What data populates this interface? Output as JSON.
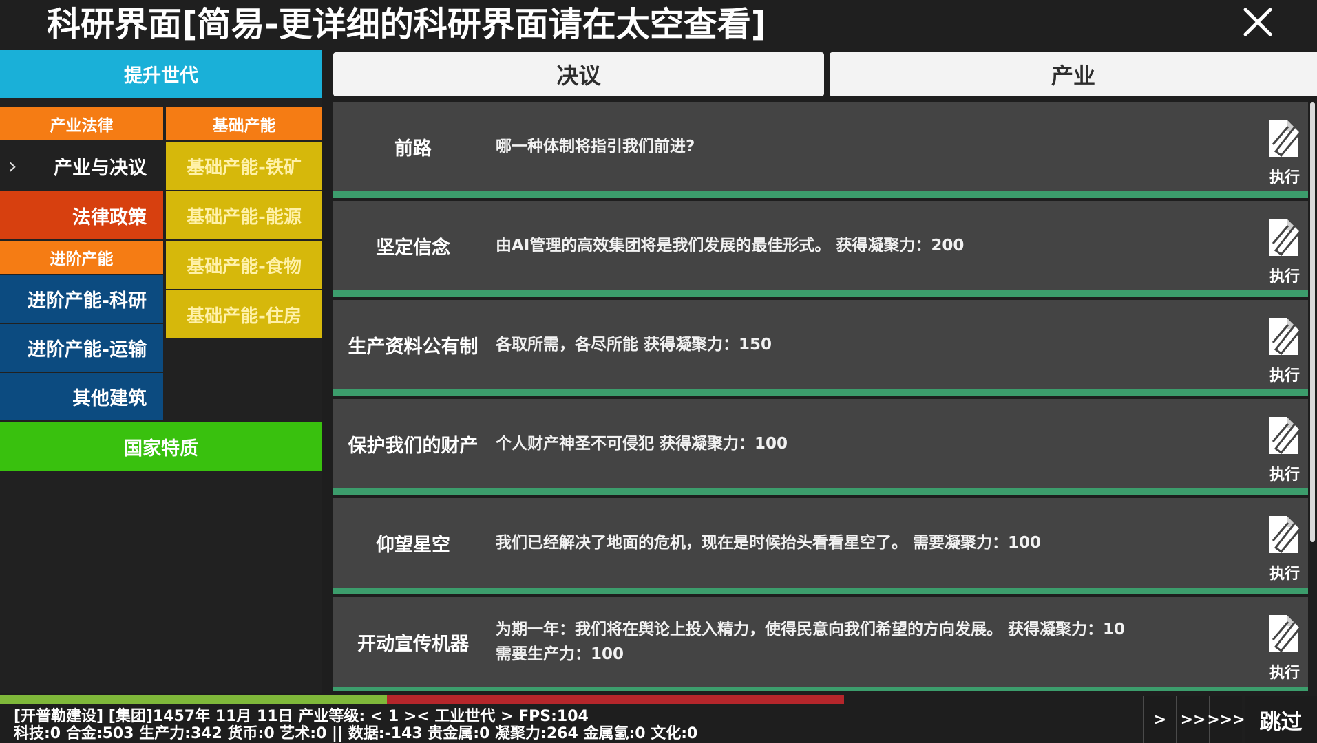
{
  "window": {
    "title": "科研界面[简易-更详细的科研界面请在太空查看]",
    "close_icon": "close-icon"
  },
  "sidebar": {
    "upgrade_label": "提升世代",
    "industry_law_header": "产业法律",
    "basic_capacity_header": "基础产能",
    "industry_decision_label": "产业与决议",
    "law_policy_label": "法律政策",
    "advanced_capacity_header": "进阶产能",
    "advanced_research_label": "进阶产能-科研",
    "advanced_transport_label": "进阶产能-运输",
    "other_buildings_label": "其他建筑",
    "basic_iron_label": "基础产能-铁矿",
    "basic_energy_label": "基础产能-能源",
    "basic_food_label": "基础产能-食物",
    "basic_housing_label": "基础产能-住房",
    "national_traits_label": "国家特质",
    "chevron_icon": "chevron-right-icon"
  },
  "tabs": {
    "resolution": "决议",
    "industry": "产业"
  },
  "decisions": [
    {
      "name": "前路",
      "desc": "哪一种体制将指引我们前进?",
      "desc2": "",
      "action": "执行"
    },
    {
      "name": "坚定信念",
      "desc": "由AI管理的高效集团将是我们发展的最佳形式。 获得凝聚力：200",
      "desc2": "",
      "action": "执行"
    },
    {
      "name": "生产资料公有制",
      "desc": "各取所需，各尽所能 获得凝聚力：150",
      "desc2": "",
      "action": "执行"
    },
    {
      "name": "保护我们的财产",
      "desc": "个人财产神圣不可侵犯 获得凝聚力：100",
      "desc2": "",
      "action": "执行"
    },
    {
      "name": "仰望星空",
      "desc": "我们已经解决了地面的危机，现在是时候抬头看看星空了。 需要凝聚力：100",
      "desc2": "",
      "action": "执行"
    },
    {
      "name": "开动宣传机器",
      "desc": "为期一年：我们将在舆论上投入精力，使得民意向我们希望的方向发展。 获得凝聚力：10",
      "desc2": "需要生产力：100",
      "action": "执行"
    }
  ],
  "status": {
    "line1": "[开普勒建设] [集团]1457年 11月 11日 产业等级: < 1 >< 工业世代 > FPS:104",
    "line2": "科技:0 合金:503 生产力:342 货币:0 艺术:0 || 数据:-143 贵金属:0 凝聚力:264 金属氢:0 文化:0",
    "progress_green": 0.294,
    "progress_red": 0.347,
    "speed1": ">",
    "speed2": ">>",
    "speed3": ">>>",
    "skip": "跳过"
  },
  "colors": {
    "sidebar_cyan": "#1ab0d8",
    "sidebar_orange": "#f57c14",
    "sidebar_yellow": "#d6b80b",
    "sidebar_blue": "#0c4b80",
    "sidebar_red": "#d7400f",
    "sidebar_green": "#39c10e",
    "row_bg": "#444444",
    "row_separator": "#3c9d6c"
  }
}
